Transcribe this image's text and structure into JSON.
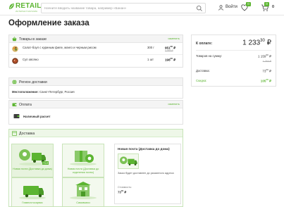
{
  "header": {
    "logo_text": "RETAIL",
    "logo_sub": "ИНТЕРНЕТ-МАГАЗИН",
    "search_placeholder": "Начните вводить название товара, например «Банан»",
    "login_label": "Войти",
    "favorites_count": "0",
    "cart_count": "0",
    "cart_sum": "0"
  },
  "page_title": "Оформление заказа",
  "goods": {
    "title": "Товары в заказе",
    "edit": "изменить",
    "items": [
      {
        "name": "Салат-боул с куриным филе, манго и черным рисом",
        "qty": "300 г",
        "price_main": "951",
        "price_cents": "90",
        "price_currency": "₽",
        "old_price": "1 064 ₽"
      },
      {
        "name": "Суп овсяно",
        "qty": "1 шт",
        "price_main": "198",
        "price_cents": "00",
        "price_currency": "₽",
        "old_price": ""
      }
    ]
  },
  "region": {
    "title": "Регион доставки",
    "label": "Местоположение:",
    "value": "Санкт-Петербург, Россия"
  },
  "payment": {
    "title": "Оплата",
    "edit": "изменить",
    "method": "Наличный расчет"
  },
  "delivery": {
    "title": "Доставка",
    "options": [
      {
        "label": "Новая почта (Доставка до дома)",
        "price": "73 ₽",
        "selected": true
      },
      {
        "label": "Новая почта (Доставка до отделения почты)",
        "price": "",
        "selected": false
      },
      {
        "label": "Главпочтоcарвис",
        "price": "",
        "selected": false
      },
      {
        "label": "Самовывоз",
        "price": "",
        "selected": false
      }
    ],
    "detail": {
      "title": "Новая почта (Доставка до дома)",
      "note": "Заказ будет доставлен до указанного адреса",
      "cost_label": "Стоимость:",
      "cost_main": "73",
      "cost_cents": "00",
      "cost_currency": "₽"
    }
  },
  "summary": {
    "total_label": "К оплате:",
    "total_main": "1 233",
    "total_cents": "30",
    "total_currency": "₽",
    "goods_label": "Товаров на сумму:",
    "goods_main": "1 159",
    "goods_cents": "90",
    "goods_currency": "₽",
    "goods_old": "1 264 ₽",
    "delivery_label": "Доставка:",
    "delivery_main": "73",
    "delivery_cents": "00",
    "delivery_currency": "₽",
    "discount_label": "Скидка:",
    "discount_main": "105",
    "discount_cents": "40",
    "discount_currency": "₽"
  },
  "colors": {
    "accent": "#5cb531",
    "panel_head": "#f4f4f4",
    "delivery_tile": "#f3f9ee"
  },
  "icons": [
    "search-icon",
    "user-icon",
    "heart-icon",
    "cart-icon",
    "basket-icon",
    "globe-icon",
    "wallet-icon",
    "box-icon",
    "truck-icon",
    "building-icon"
  ]
}
